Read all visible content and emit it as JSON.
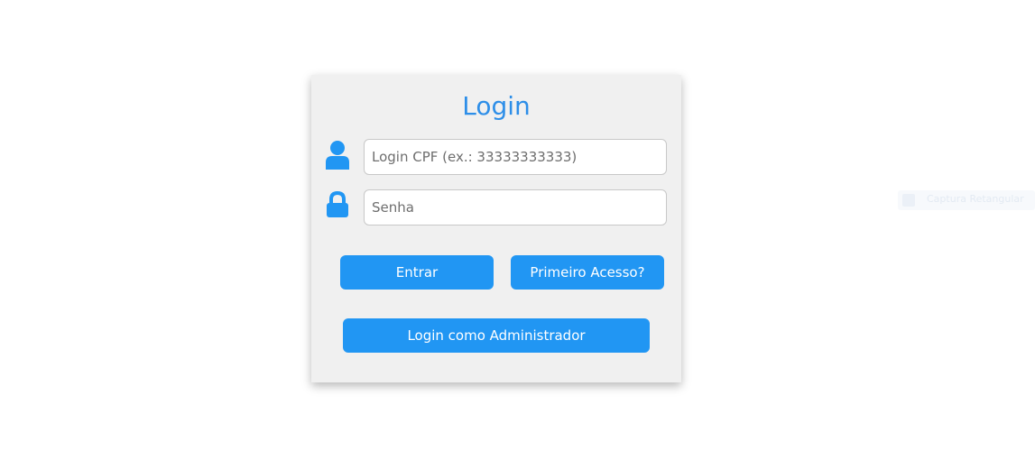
{
  "login_card": {
    "title": "Login",
    "cpf_field": {
      "placeholder": "Login CPF (ex.: 33333333333)",
      "value": ""
    },
    "password_field": {
      "placeholder": "Senha",
      "value": ""
    },
    "buttons": {
      "enter_label": "Entrar",
      "first_access_label": "Primeiro Acesso?",
      "admin_login_label": "Login como Administrador"
    },
    "icons": {
      "user": "user-icon",
      "lock": "lock-icon"
    }
  },
  "extension_widget": {
    "label": "Captura Retangular",
    "icon": "capture-icon"
  },
  "colors": {
    "accent": "#2196f3",
    "title": "#2d8ee8",
    "card_background": "#f0f0f0",
    "page_background": "#ffffff"
  }
}
